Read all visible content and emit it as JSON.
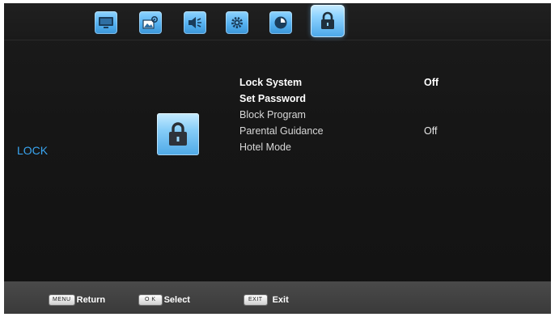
{
  "tabs": [
    {
      "icon": "tv-picture-icon",
      "active": false
    },
    {
      "icon": "picture-settings-icon",
      "active": false
    },
    {
      "icon": "sound-icon",
      "active": false
    },
    {
      "icon": "settings-gear-icon",
      "active": false
    },
    {
      "icon": "clock-time-icon",
      "active": false
    },
    {
      "icon": "lock-icon",
      "active": true
    }
  ],
  "section": {
    "title": "LOCK"
  },
  "menu": {
    "items": [
      {
        "label": "Lock System",
        "value": "Off"
      },
      {
        "label": "Set Password",
        "value": ""
      },
      {
        "label": "Block Program",
        "value": ""
      },
      {
        "label": "Parental Guidance",
        "value": "Off"
      },
      {
        "label": "Hotel Mode",
        "value": ""
      }
    ]
  },
  "footer": {
    "menu_key": "MENU",
    "menu_label": "Return",
    "ok_key": "O K",
    "ok_label": "Select",
    "exit_key": "EXIT",
    "exit_label": "Exit"
  },
  "colors": {
    "accent": "#3aa6f2",
    "tab_blue": "#55b1f0",
    "background": "#161616",
    "footer": "#444444"
  }
}
